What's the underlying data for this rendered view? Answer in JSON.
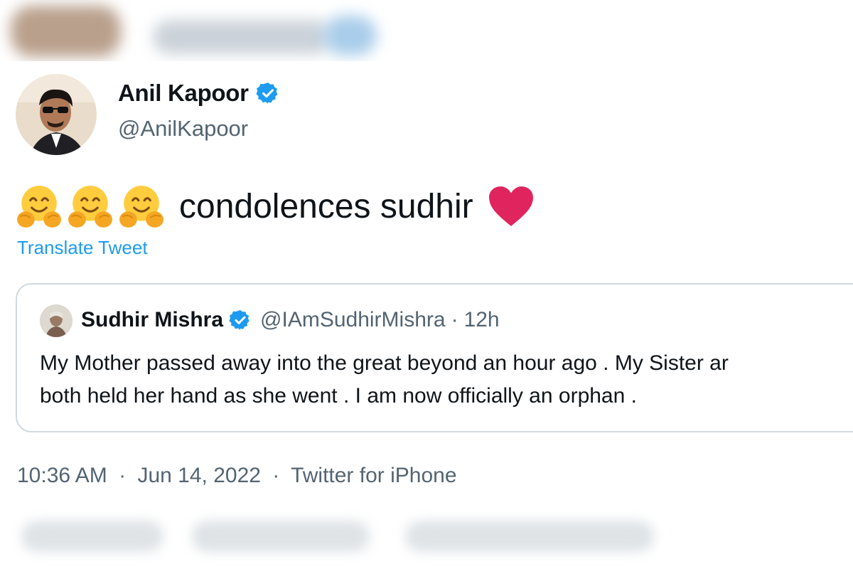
{
  "author": {
    "name": "Anil Kapoor",
    "handle": "@AnilKapoor",
    "avatar_icon": "profile-photo-avatar",
    "verified_icon": "verified-badge-icon"
  },
  "tweet": {
    "emojis": [
      "hugging-face-emoji",
      "hugging-face-emoji",
      "hugging-face-emoji"
    ],
    "text": "condolences sudhir",
    "trailing_emoji": "red-heart-emoji",
    "translate_label": "Translate Tweet"
  },
  "quoted_tweet": {
    "name": "Sudhir Mishra",
    "handle": "@IAmSudhirMishra",
    "separator": "·",
    "time": "12h",
    "line1": "My Mother passed away into the great beyond an hour ago . My Sister  ar",
    "line2": "both held her hand as she went . I am now officially an orphan ."
  },
  "meta": {
    "time": "10:36 AM",
    "date": "Jun 14, 2022",
    "source": "Twitter for iPhone",
    "separator": "·"
  },
  "colors": {
    "accent": "#1d9bf0",
    "text": "#0f1419",
    "muted": "#536471",
    "border": "#cfd9de",
    "heart": "#e0245e"
  }
}
